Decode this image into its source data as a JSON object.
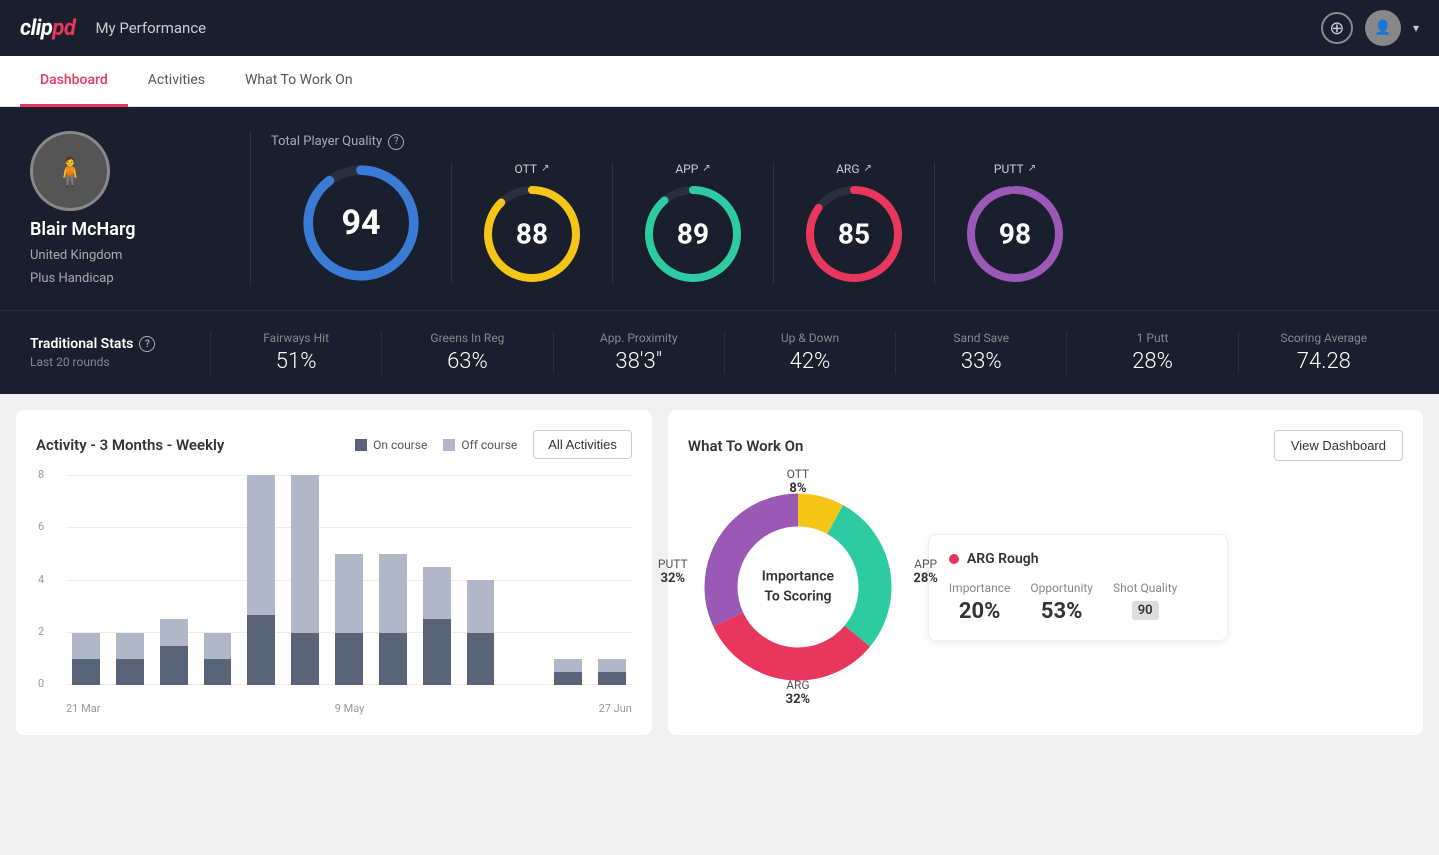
{
  "header": {
    "logo_text": "clippd",
    "title": "My Performance",
    "add_icon": "+",
    "chevron": "▾"
  },
  "nav": {
    "tabs": [
      {
        "label": "Dashboard",
        "active": true
      },
      {
        "label": "Activities",
        "active": false
      },
      {
        "label": "What To Work On",
        "active": false
      }
    ]
  },
  "player": {
    "name": "Blair McHarg",
    "country": "United Kingdom",
    "handicap": "Plus Handicap"
  },
  "quality": {
    "label": "Total Player Quality",
    "overall": {
      "value": "94",
      "color": "#3a7bd5"
    },
    "ott": {
      "label": "OTT",
      "value": "88",
      "color": "#f5c518"
    },
    "app": {
      "label": "APP",
      "value": "89",
      "color": "#2ecba1"
    },
    "arg": {
      "label": "ARG",
      "value": "85",
      "color": "#e8365d"
    },
    "putt": {
      "label": "PUTT",
      "value": "98",
      "color": "#9b59b6"
    }
  },
  "trad_stats": {
    "title": "Traditional Stats",
    "sub": "Last 20 rounds",
    "stats": [
      {
        "label": "Fairways Hit",
        "value": "51%"
      },
      {
        "label": "Greens In Reg",
        "value": "63%"
      },
      {
        "label": "App. Proximity",
        "value": "38'3\""
      },
      {
        "label": "Up & Down",
        "value": "42%"
      },
      {
        "label": "Sand Save",
        "value": "33%"
      },
      {
        "label": "1 Putt",
        "value": "28%"
      },
      {
        "label": "Scoring Average",
        "value": "74.28"
      }
    ]
  },
  "activity_chart": {
    "title": "Activity - 3 Months - Weekly",
    "legend_on": "On course",
    "legend_off": "Off course",
    "btn_label": "All Activities",
    "x_labels": [
      "21 Mar",
      "9 May",
      "27 Jun"
    ],
    "bars": [
      {
        "on": 1,
        "off": 1
      },
      {
        "on": 1,
        "off": 1
      },
      {
        "on": 1.5,
        "off": 1
      },
      {
        "on": 1,
        "off": 1
      },
      {
        "on": 3,
        "off": 6
      },
      {
        "on": 2,
        "off": 6
      },
      {
        "on": 2,
        "off": 3
      },
      {
        "on": 2,
        "off": 3
      },
      {
        "on": 2.5,
        "off": 2
      },
      {
        "on": 2,
        "off": 2
      },
      {
        "on": 0,
        "off": 0
      },
      {
        "on": 0.5,
        "off": 0.5
      },
      {
        "on": 0.5,
        "off": 0.5
      }
    ],
    "y_max": 8,
    "color_on": "#5a6478",
    "color_off": "#b0b8c8"
  },
  "what_to_work": {
    "title": "What To Work On",
    "btn_label": "View Dashboard",
    "donut_center": "Importance\nTo Scoring",
    "segments": [
      {
        "label": "OTT",
        "pct": "8%",
        "color": "#f5c518",
        "angle": 0,
        "sweep": 29
      },
      {
        "label": "APP",
        "pct": "28%",
        "color": "#2ecba1",
        "angle": 29,
        "sweep": 101
      },
      {
        "label": "ARG",
        "pct": "32%",
        "color": "#e8365d",
        "angle": 130,
        "sweep": 115
      },
      {
        "label": "PUTT",
        "pct": "32%",
        "color": "#9b59b6",
        "angle": 245,
        "sweep": 115
      }
    ],
    "arg_box": {
      "title": "ARG Rough",
      "importance_label": "Importance",
      "importance_val": "20%",
      "opportunity_label": "Opportunity",
      "opportunity_val": "53%",
      "quality_label": "Shot Quality",
      "quality_val": "90"
    }
  }
}
